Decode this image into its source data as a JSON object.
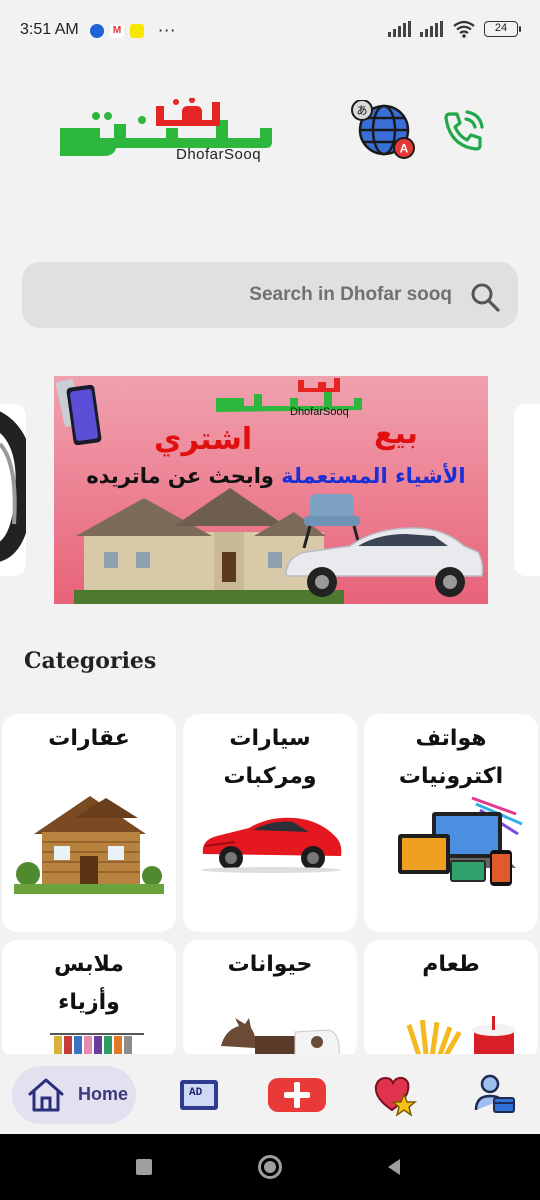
{
  "status_bar": {
    "time": "3:51 AM",
    "more": "···",
    "battery": "24"
  },
  "header": {
    "logo_arabic": "ظفار سوق",
    "logo_english": "DhofarSooq"
  },
  "search": {
    "placeholder": "Search in Dhofar sooq"
  },
  "banner": {
    "logo_arabic": "ظفار سوق",
    "logo_english": "DhofarSooq",
    "sell": "بيع",
    "buy": "اشتري",
    "line_blue": "الأشياء المستعملة",
    "line_black": "وابحث عن ماتريده"
  },
  "categories": {
    "title": "Categories",
    "items": [
      {
        "line1": "عقارات",
        "line2": "",
        "icon": "house-image"
      },
      {
        "line1": "سيارات",
        "line2": "ومركبات",
        "icon": "car-image"
      },
      {
        "line1": "هواتف",
        "line2": "اكترونيات",
        "icon": "electronics-image"
      },
      {
        "line1": "ملابس",
        "line2": "وأزياء",
        "icon": "clothes-image"
      },
      {
        "line1": "حيوانات",
        "line2": "",
        "icon": "goat-image"
      },
      {
        "line1": "طعام",
        "line2": "",
        "icon": "food-image"
      }
    ]
  },
  "bottom_nav": {
    "home_label": "Home",
    "ad_label": "AD",
    "items": [
      "home-icon",
      "ad-icon",
      "add-icon",
      "favorites-icon",
      "profile-icon"
    ]
  },
  "colors": {
    "brand_green": "#2db83d",
    "brand_red": "#e52424",
    "accent_purple": "#3b3a7c",
    "nav_active_bg": "#e3e1f0"
  }
}
